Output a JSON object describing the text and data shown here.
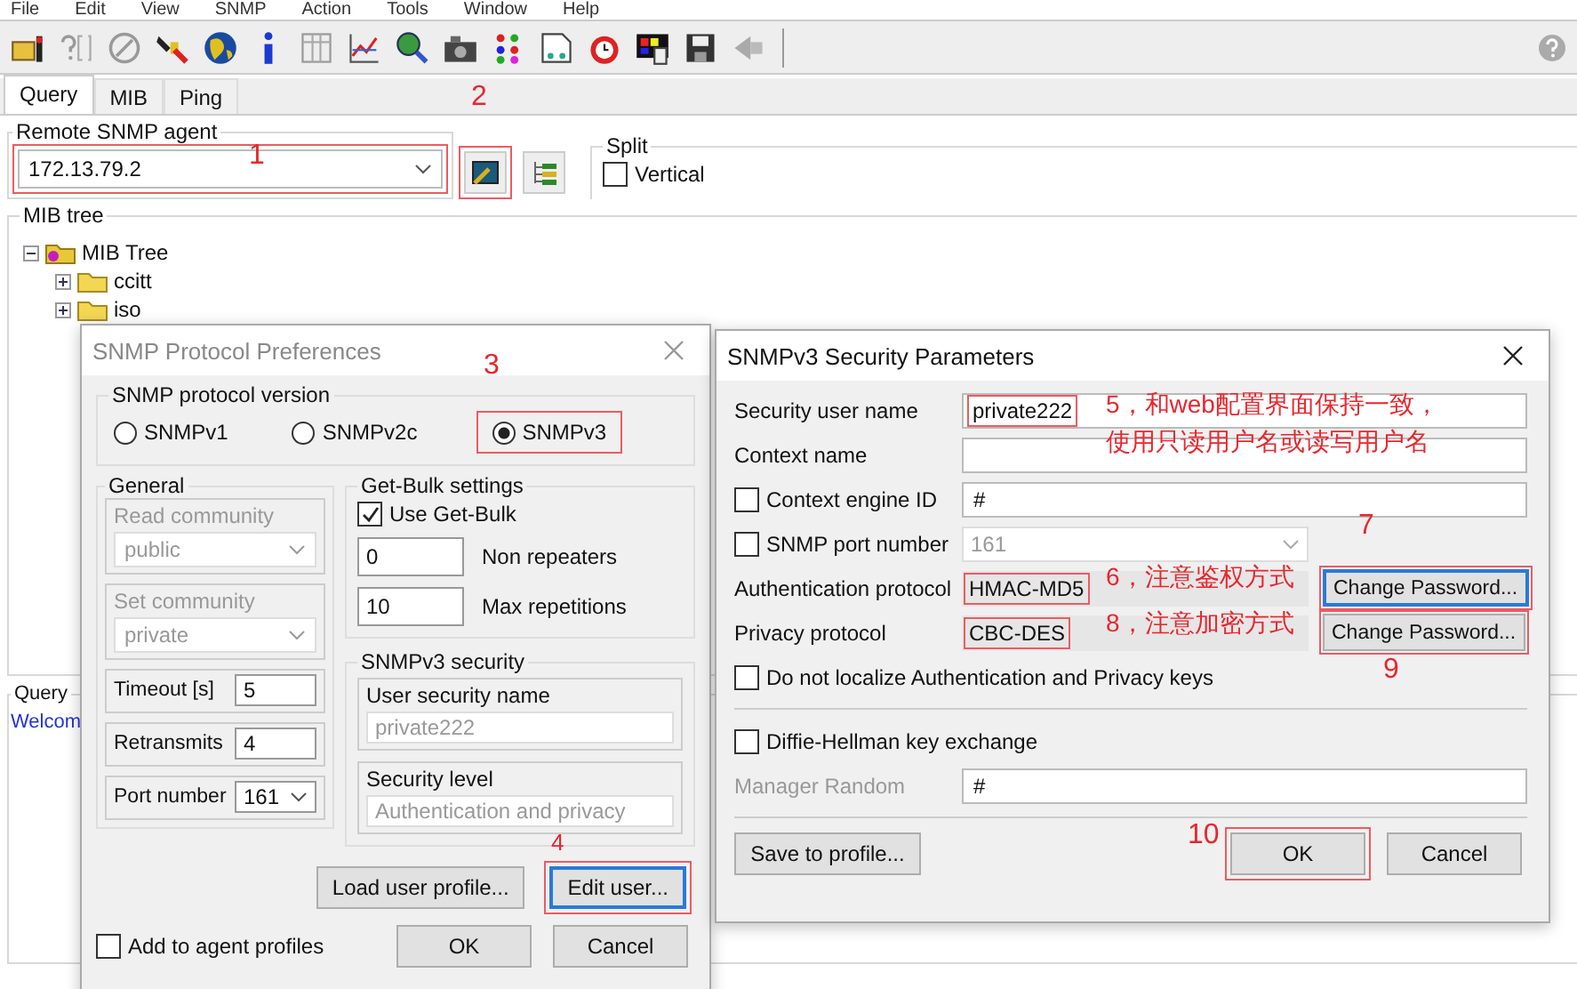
{
  "menu": [
    "File",
    "Edit",
    "View",
    "SNMP",
    "Action",
    "Tools",
    "Window",
    "Help"
  ],
  "toolbar": [
    {
      "kind": "open"
    },
    {
      "kind": "question"
    },
    {
      "kind": "stop"
    },
    {
      "kind": "tools"
    },
    {
      "kind": "globe"
    },
    {
      "kind": "info"
    },
    {
      "kind": "grid"
    },
    {
      "kind": "chart"
    },
    {
      "kind": "find"
    },
    {
      "kind": "camera"
    },
    {
      "kind": "dots"
    },
    {
      "kind": "document"
    },
    {
      "kind": "alarm"
    },
    {
      "kind": "palette"
    },
    {
      "kind": "disk"
    },
    {
      "kind": "back"
    }
  ],
  "tabs": [
    {
      "label": "Query",
      "selected": true
    },
    {
      "label": "MIB",
      "selected": false
    },
    {
      "label": "Ping",
      "selected": false
    }
  ],
  "agent": {
    "label": "Remote SNMP agent",
    "value": "172.13.79.2",
    "highlighted": true
  },
  "agent_buttons": [
    {
      "kind": "connect",
      "highlighted": true
    },
    {
      "kind": "tree",
      "highlighted": false
    }
  ],
  "split": {
    "label": "Split",
    "vertical": {
      "label": "Vertical",
      "checked": false
    }
  },
  "mib_tree": {
    "label": "MIB tree",
    "root": {
      "label": "MIB Tree",
      "expanded": true,
      "children": [
        {
          "label": "ccitt",
          "expanded": false
        },
        {
          "label": "iso",
          "expanded": false
        }
      ]
    }
  },
  "query": {
    "label": "Query",
    "message": "Welcom"
  },
  "prefs_dialog": {
    "title": "SNMP Protocol Preferences",
    "active": false,
    "version": {
      "label": "SNMP protocol version",
      "options": [
        {
          "label": "SNMPv1",
          "selected": false,
          "highlighted": false
        },
        {
          "label": "SNMPv2c",
          "selected": false,
          "highlighted": false
        },
        {
          "label": "SNMPv3",
          "selected": true,
          "highlighted": true
        }
      ]
    },
    "general": {
      "label": "General",
      "read_community": {
        "label": "Read community",
        "value": "public",
        "disabled": true
      },
      "set_community": {
        "label": "Set community",
        "value": "private",
        "disabled": true
      },
      "timeout": {
        "label": "Timeout [s]",
        "value": "5"
      },
      "retransmits": {
        "label": "Retransmits",
        "value": "4"
      },
      "port": {
        "label": "Port number",
        "value": "161"
      }
    },
    "get_bulk": {
      "label": "Get-Bulk settings",
      "use": {
        "label": "Use Get-Bulk",
        "checked": true
      },
      "non_repeaters": {
        "label": "Non repeaters",
        "value": "0"
      },
      "max_repetitions": {
        "label": "Max repetitions",
        "value": "10"
      }
    },
    "v3": {
      "label": "SNMPv3 security",
      "user": {
        "label": "User security name",
        "value": "private222"
      },
      "level": {
        "label": "Security level",
        "value": "Authentication and privacy"
      }
    },
    "buttons": [
      {
        "label": "Load user profile...",
        "highlighted": false,
        "focused": false
      },
      {
        "label": "Edit user...",
        "highlighted": true,
        "focused": true
      }
    ],
    "add_to_profiles": {
      "label": "Add to agent profiles",
      "checked": false
    },
    "footer_buttons": [
      {
        "label": "OK"
      },
      {
        "label": "Cancel"
      }
    ]
  },
  "security_dialog": {
    "title": "SNMPv3 Security Parameters",
    "active": true,
    "rows": [
      {
        "kind": "text",
        "label": "Security user name",
        "value": "private222",
        "highlighted": true
      },
      {
        "kind": "text",
        "label": "Context name"
      },
      {
        "kind": "check-text",
        "label": "Context engine ID",
        "checked": false,
        "value": "#"
      },
      {
        "kind": "check-combo",
        "label": "SNMP port number",
        "checked": false,
        "value": "161"
      },
      {
        "kind": "protocol",
        "label": "Authentication protocol",
        "value": "HMAC-MD5",
        "highlighted": true,
        "button": {
          "label": "Change Password...",
          "focused": true,
          "highlighted": true
        }
      },
      {
        "kind": "protocol",
        "label": "Privacy protocol",
        "value": "CBC-DES",
        "highlighted": true,
        "button": {
          "label": "Change Password...",
          "focused": false,
          "highlighted": true
        }
      },
      {
        "kind": "check",
        "label": "Do not localize Authentication and Privacy keys",
        "checked": false
      }
    ],
    "dh_rows": [
      {
        "kind": "check",
        "label": "Diffie-Hellman key exchange",
        "checked": false
      },
      {
        "kind": "text",
        "label": "Manager Random",
        "value": "#",
        "disabled": true
      }
    ],
    "save_button": {
      "label": "Save to profile..."
    },
    "buttons": [
      {
        "label": "OK",
        "highlighted": true
      },
      {
        "label": "Cancel",
        "highlighted": false
      }
    ]
  },
  "annotations": [
    {
      "text": "1"
    },
    {
      "text": "2"
    },
    {
      "text": "3"
    },
    {
      "text": "4"
    },
    {
      "text": "5，和web配置界面保持一致，"
    },
    {
      "text": "使用只读用户名或读写用户名"
    },
    {
      "text": "6，注意鉴权方式"
    },
    {
      "text": "7"
    },
    {
      "text": "8，注意加密方式"
    },
    {
      "text": "9"
    },
    {
      "text": "10"
    }
  ]
}
